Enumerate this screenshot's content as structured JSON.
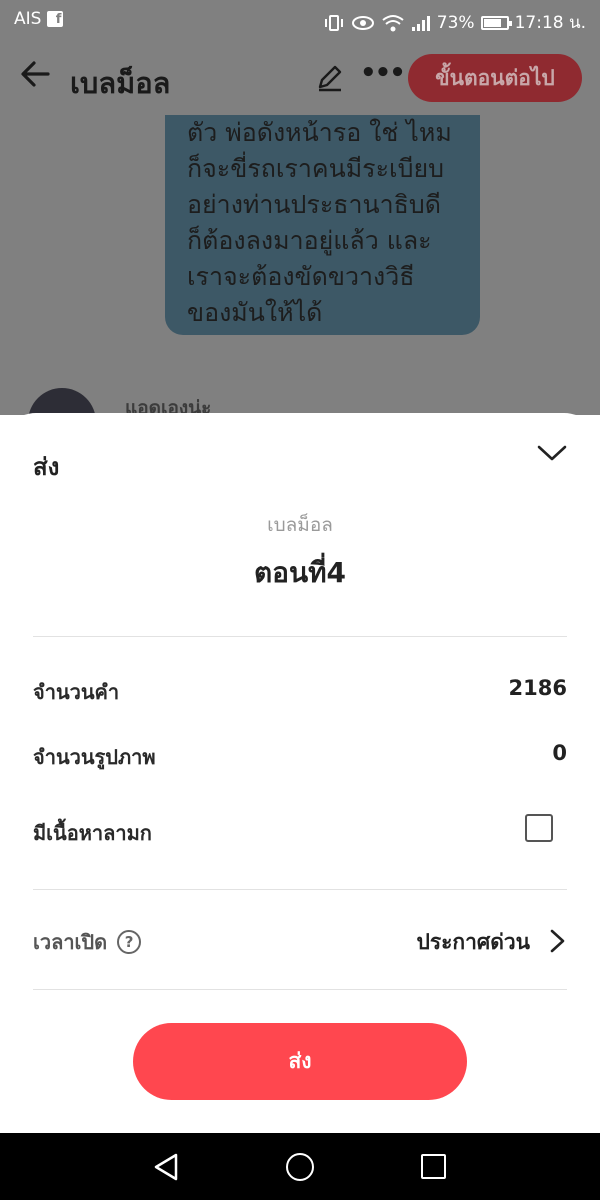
{
  "status_bar": {
    "carrier": "AIS",
    "battery_percent": "73%",
    "battery_level": 0.73,
    "time": "17:18 น.",
    "icons": [
      "facebook-icon",
      "vibrate-icon",
      "eye-icon",
      "wifi-icon",
      "signal-icon",
      "battery-icon"
    ]
  },
  "app_bar": {
    "title": "เบลม็อล",
    "next_label": "ขั้นตอนต่อไป",
    "icons": [
      "back-arrow-icon",
      "pencil-icon",
      "more-icon"
    ]
  },
  "content": {
    "bubble_text": "ตัว พ่อดังหน้ารอ ใช่ ไหม\nก็จะขี่รถเราคนมีระเบียบ\nอย่างท่านประธานาธิบดี\nก็ต้องลงมาอยู่แล้ว และ\nเราจะต้องขัดขวางวิธี\nของมันให้ได้",
    "commenter_name": "แอดเองน่ะ"
  },
  "sheet": {
    "title": "ส่ง",
    "story_name": "เบลม็อล",
    "chapter_name": "ตอนที่4",
    "word_count_label": "จำนวนคำ",
    "word_count_value": "2186",
    "image_count_label": "จำนวนรูปภาพ",
    "image_count_value": "0",
    "mature_label": "มีเนื้อหาลามก",
    "mature_checked": false,
    "release_label": "เวลาเปิด",
    "release_value": "ประกาศด่วน",
    "send_label": "ส่ง",
    "colors": {
      "accent": "#ff474f",
      "text": "#222222",
      "muted": "#9a9a9a"
    }
  },
  "nav_bar": {
    "icons": [
      "nav-back-icon",
      "nav-home-icon",
      "nav-recent-icon"
    ]
  }
}
